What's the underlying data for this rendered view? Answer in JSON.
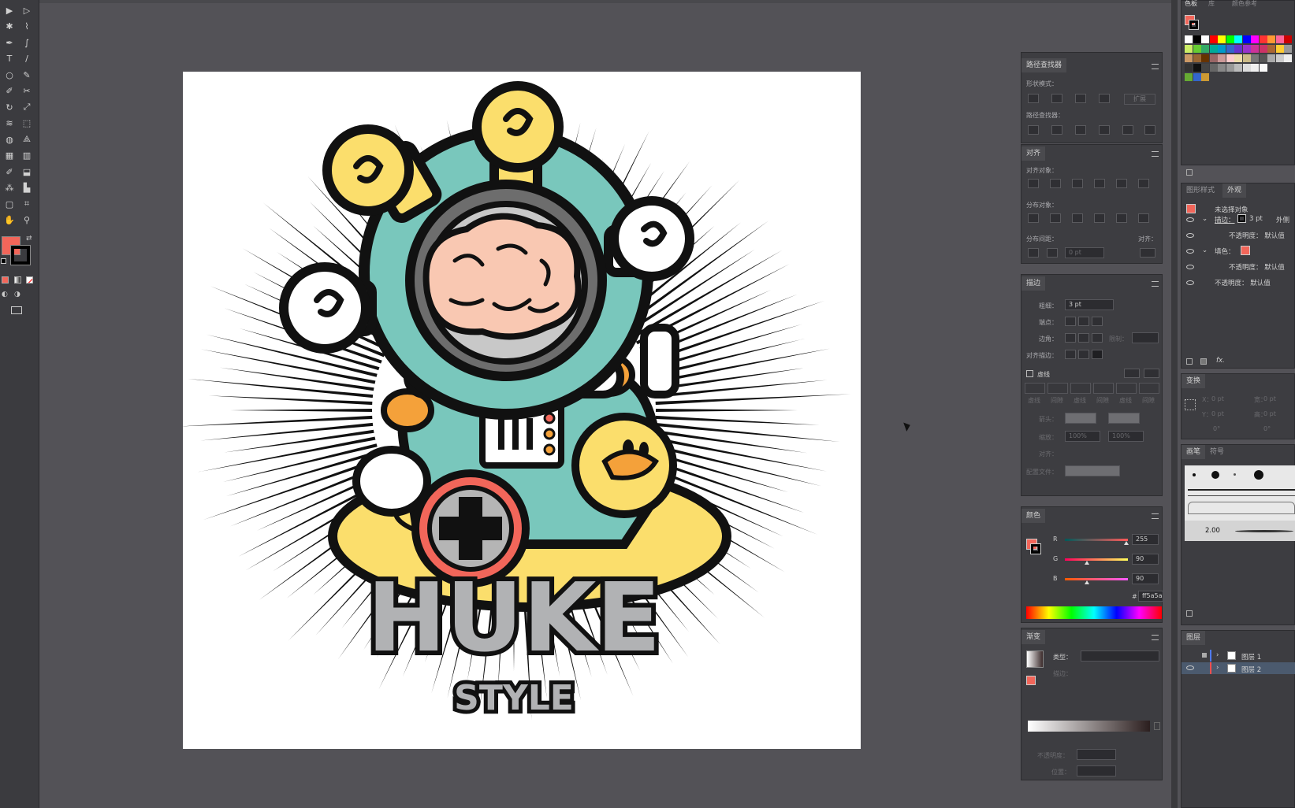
{
  "colors": {
    "fill": "#f2665a",
    "stroke": "#000000",
    "teal": "#79c7bc",
    "yellow": "#fbde6c",
    "brain": "#f9c8b2",
    "logo_gray": "#b1b2b4"
  },
  "toolbar": {
    "icons": [
      "selection-tool",
      "direct-selection-tool",
      "magic-wand-tool",
      "lasso-tool",
      "pen-tool",
      "curvature-tool",
      "type-tool",
      "line-tool",
      "ellipse-tool",
      "paintbrush-tool",
      "shaper-tool",
      "scissors-tool",
      "rotate-tool",
      "scale-tool",
      "warp-tool",
      "free-transform-tool",
      "shape-builder-tool",
      "perspective-tool",
      "mesh-tool",
      "gradient-tool",
      "eyedropper-tool",
      "blend-tool",
      "symbol-sprayer-tool",
      "column-graph-tool",
      "artboard-tool",
      "slice-tool",
      "hand-tool",
      "zoom-tool"
    ]
  },
  "artwork": {
    "title": "HUKE",
    "subtitle": "STYLE"
  },
  "pathfinder": {
    "tab": "路径查找器",
    "shape_modes_label": "形状模式：",
    "expand_label": "扩展",
    "pathfinders_label": "路径查找器："
  },
  "align": {
    "tab": "对齐",
    "align_objects_label": "对齐对象：",
    "distribute_objects_label": "分布对象：",
    "distribute_spacing_label": "分布间距：",
    "align_to_label": "对齐：",
    "spacing_value": "0 pt"
  },
  "stroke": {
    "tab": "描边",
    "weight_label": "粗细：",
    "weight_value": "3 pt",
    "cap_label": "端点：",
    "corner_label": "边角：",
    "limit_label": "限制：",
    "align_label": "对齐描边：",
    "dashed_label": "虚线",
    "dash_labels": [
      "虚线",
      "间隙",
      "虚线",
      "间隙",
      "虚线",
      "间隙"
    ],
    "arrow_label": "箭头：",
    "scale_label": "缩放：",
    "scale_values": [
      "100%",
      "100%"
    ],
    "align_arrow_label": "对齐：",
    "profile_label": "配置文件："
  },
  "color": {
    "tab": "颜色",
    "channels": [
      {
        "label": "R",
        "value": "255",
        "pos": 0.97,
        "grad": "linear-gradient(90deg,#00595a,#ff595a)"
      },
      {
        "label": "G",
        "value": "90",
        "pos": 0.35,
        "grad": "linear-gradient(90deg,#ff005a,#ffff5a)"
      },
      {
        "label": "B",
        "value": "90",
        "pos": 0.35,
        "grad": "linear-gradient(90deg,#ff5a00,#ff5aff)"
      }
    ],
    "hex_label": "#",
    "hex_value": "ff5a5a"
  },
  "gradient": {
    "tab": "渐变",
    "type_label": "类型：",
    "stroke_label": "描边：",
    "opacity_label": "不透明度：",
    "location_label": "位置："
  },
  "swatches_header": {
    "tabs": [
      "色板",
      "库",
      "颜色参考"
    ]
  },
  "appearance": {
    "tabs": [
      "图形样式",
      "外观"
    ],
    "title": "未选择对象",
    "rows": [
      {
        "label": "描边：",
        "value": "3 pt",
        "extra": "外侧"
      },
      {
        "label": "不透明度：",
        "value": "默认值"
      },
      {
        "label": "填色：",
        "value": ""
      },
      {
        "label": "不透明度：",
        "value": "默认值"
      },
      {
        "label": "不透明度：",
        "value": "默认值"
      }
    ],
    "fx": "fx."
  },
  "transform": {
    "tab": "变换",
    "x_label": "X：",
    "x_value": "0 pt",
    "w_label": "宽：",
    "w_value": "0 pt",
    "y_label": "Y：",
    "y_value": "0 pt",
    "h_label": "高：",
    "h_value": "0 pt",
    "angle_value": "0°",
    "shear_value": "0°"
  },
  "brushes": {
    "tabs": [
      "画笔",
      "符号"
    ],
    "brush_size": "2.00"
  },
  "layers": {
    "tab": "图层",
    "items": [
      {
        "name": "图层 1",
        "selected": false
      },
      {
        "name": "图层 2",
        "selected": true
      }
    ]
  }
}
